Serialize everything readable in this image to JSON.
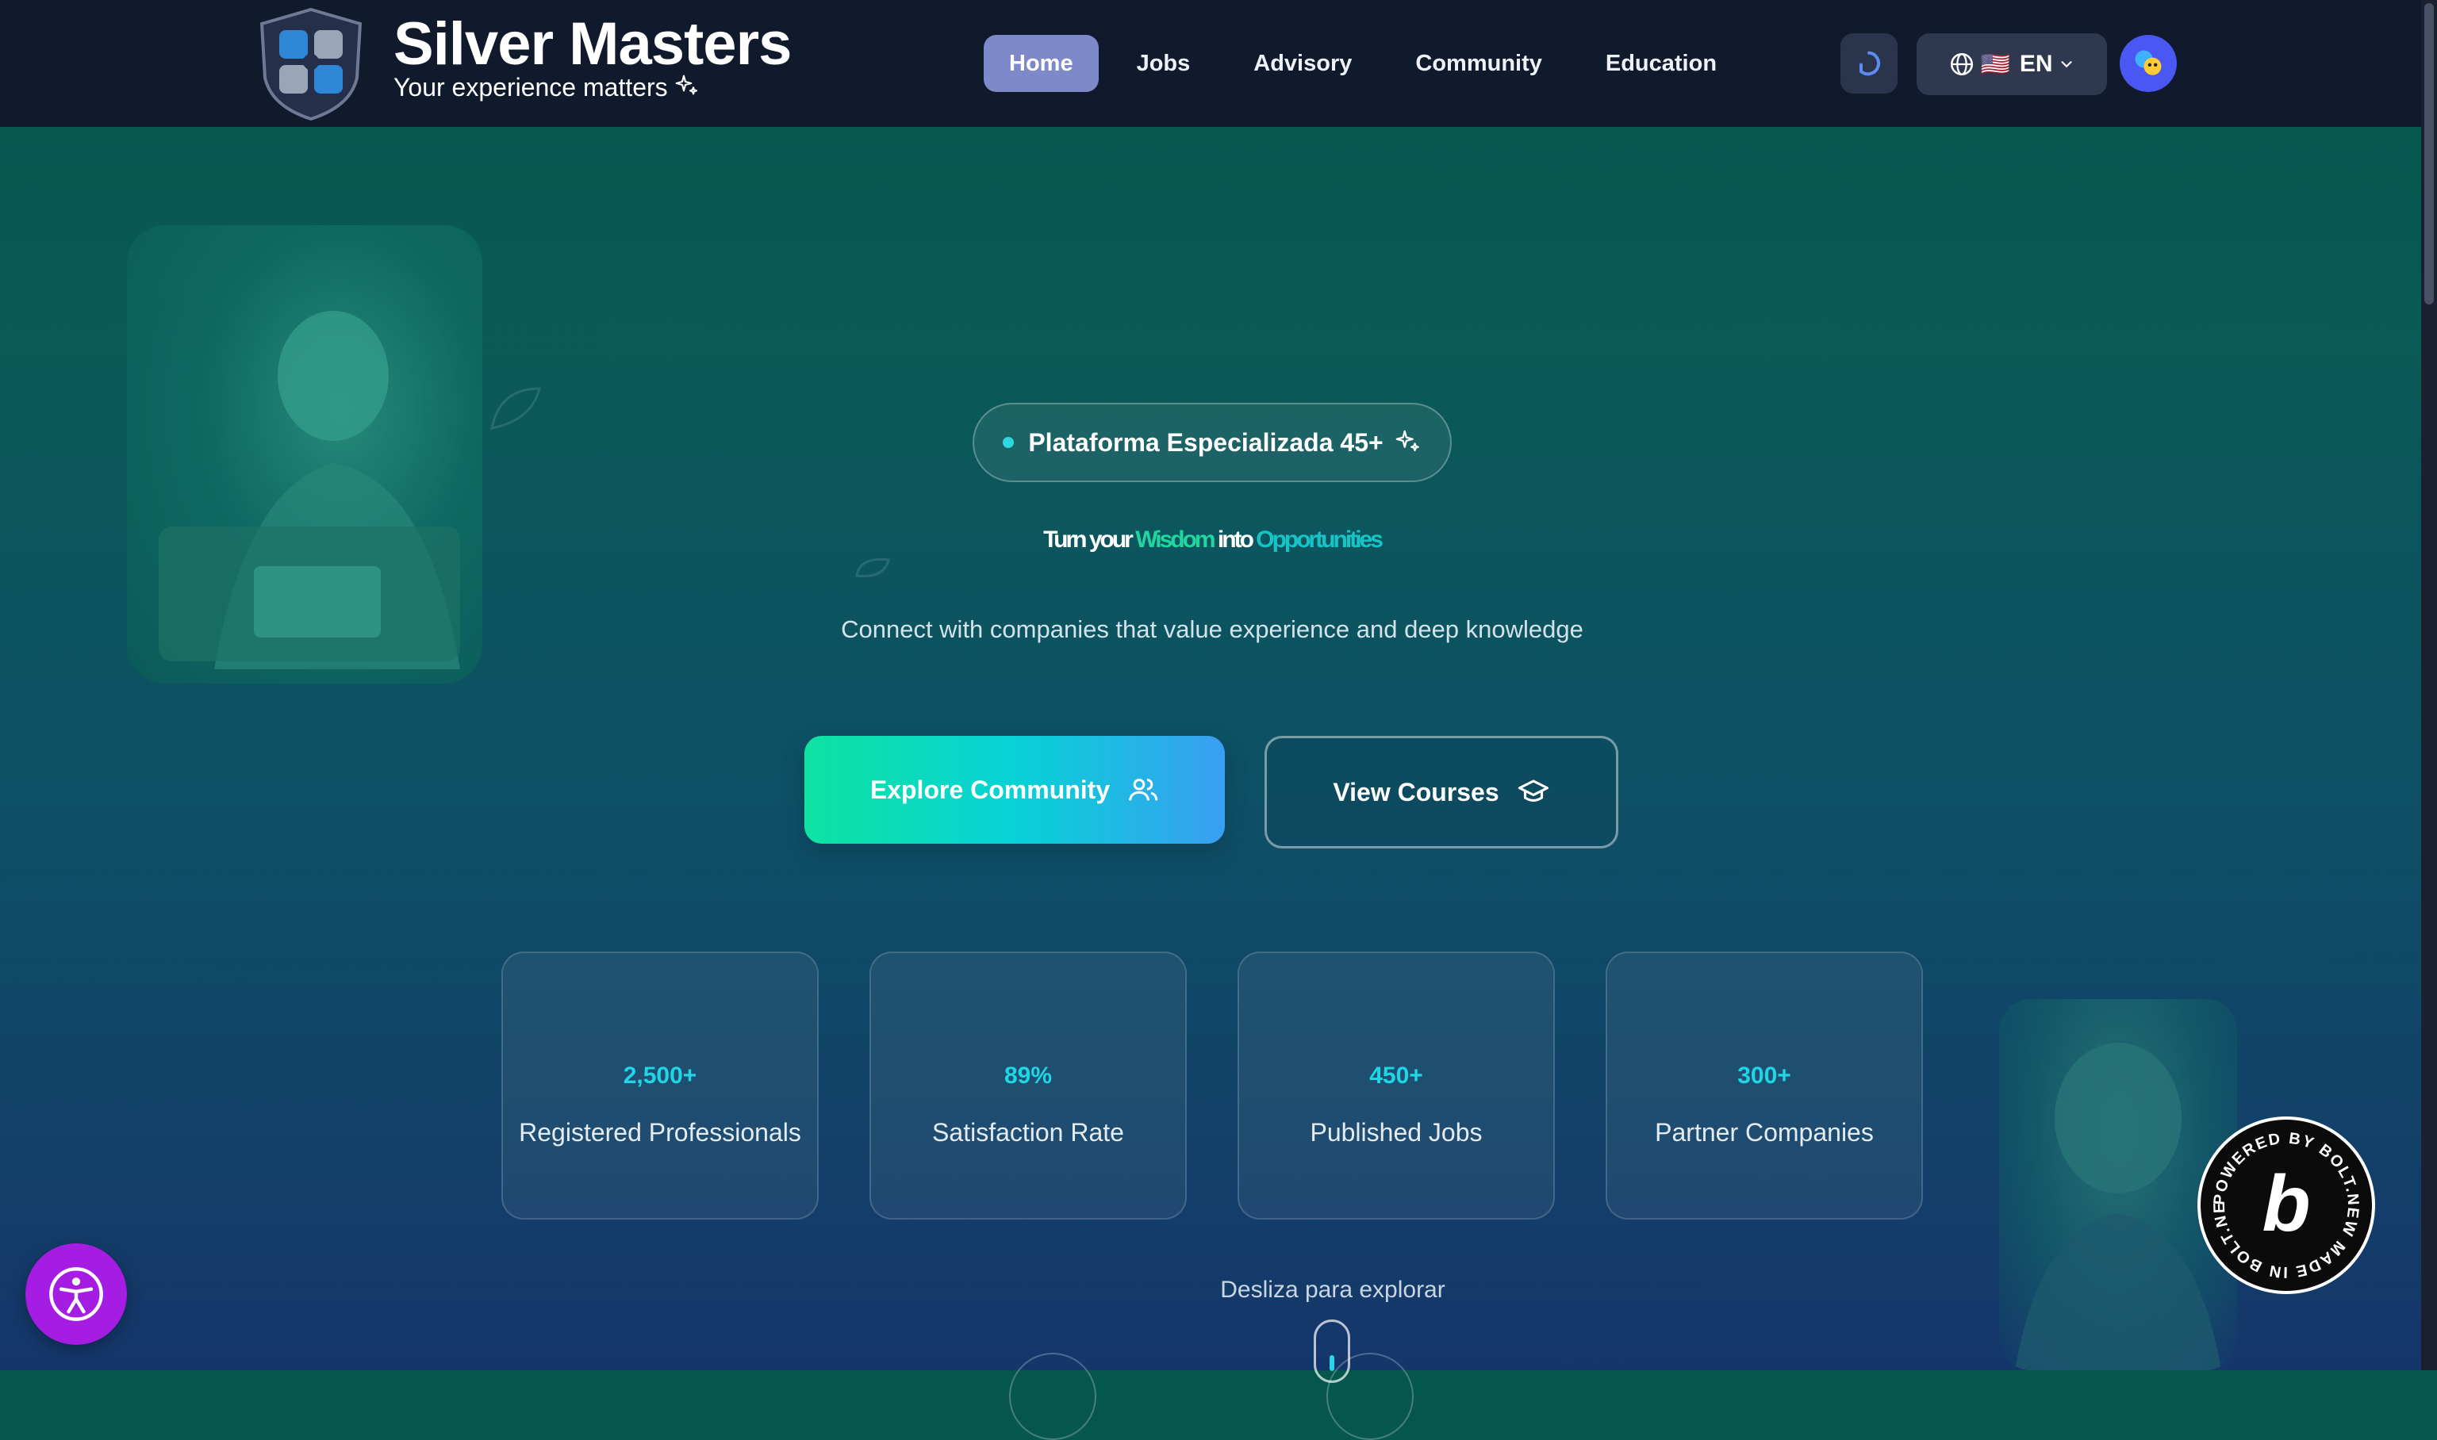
{
  "brand": {
    "name": "Silver Masters",
    "tagline": "Your experience matters"
  },
  "nav": {
    "items": [
      {
        "label": "Home",
        "active": true
      },
      {
        "label": "Jobs",
        "active": false
      },
      {
        "label": "Advisory",
        "active": false
      },
      {
        "label": "Community",
        "active": false
      },
      {
        "label": "Education",
        "active": false
      }
    ]
  },
  "toolbar": {
    "refresh_icon": "refresh-icon",
    "language_icon": "globe-icon",
    "language_flag": "🇺🇸",
    "language_code": "EN",
    "avatar_icon": "user-avatar"
  },
  "hero": {
    "badge": "Plataforma Especializada 45+",
    "headline": {
      "part1": "Turn your ",
      "part2": "Wisdom",
      "part3": " into ",
      "part4": "Opportunities"
    },
    "subtitle": "Connect with companies that value experience and deep knowledge",
    "cta_primary": "Explore Community",
    "cta_secondary": "View Courses"
  },
  "stats": [
    {
      "value": "2,500+",
      "label": "Registered Professionals"
    },
    {
      "value": "89%",
      "label": "Satisfaction Rate"
    },
    {
      "value": "450+",
      "label": "Published Jobs"
    },
    {
      "value": "300+",
      "label": "Partner Companies"
    }
  ],
  "scroll_hint": "Desliza para explorar",
  "bolt_badge": {
    "text": "POWERED BY BOLT.NEW MADE IN BOLT.NEW",
    "letter": "b"
  },
  "colors": {
    "accent": "#1ed6e6",
    "header_bg": "#111a2c",
    "nav_active": "#7d89c9",
    "cta_gradient_start": "#0fe3a2",
    "cta_gradient_end": "#3a9ef2",
    "a11y_button": "#a51ce2"
  }
}
